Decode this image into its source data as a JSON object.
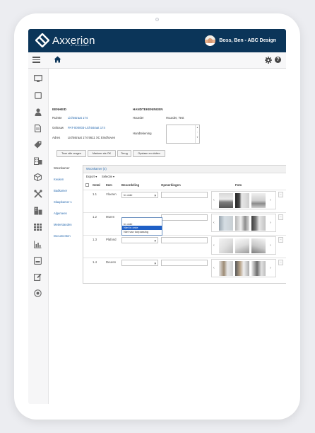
{
  "app": {
    "logo_text": "Axxerion",
    "logo_sub": "BY SPACEWELL",
    "user_label": "Boss, Ben - ABC Design"
  },
  "icons": {
    "menu": "hamburger-menu-icon",
    "home": "home-icon",
    "settings": "gear-icon",
    "help": "help-icon",
    "help_glyph": "?"
  },
  "eenheid": {
    "heading": "EENHEID",
    "ruimte_label": "Ruimte",
    "ruimte_value": "Lichtstraat 174",
    "gebouw_label": "Gebouw",
    "gebouw_value": "PAT-000003-Lichtstraat 174",
    "adres_label": "Adres",
    "adres_value": "Lichtstraat 174 5611 XC Eindhoven"
  },
  "handtekeningen": {
    "heading": "HANDTEKENINGEN",
    "huurder_label": "Huurder",
    "huurder_value": "Huurder, Test",
    "handtekening_label": "Handtekening"
  },
  "buttons": {
    "toon_alle_vragen": "Toon alle vragen",
    "markeer_als_ok": "Markeer als OK",
    "terug": "Terug",
    "opslaan_en_sluiten": "Opslaan en sluiten"
  },
  "tabs": [
    "Woonkamer",
    "Keuken",
    "Badkamer",
    "Slaapkamer 1",
    "Algemeen",
    "Meterstanden",
    "Documenten"
  ],
  "panel": {
    "title": "Woonkamer (4)",
    "export_label": "Export ▾",
    "selectie_label": "Selectie ▾",
    "columns": [
      "Getal",
      "Item",
      "Beoordeling",
      "Opmerkingen",
      "Foto"
    ],
    "rows": [
      {
        "getal": "1.1",
        "item": "Vloeren",
        "beoordeling": "In orde"
      },
      {
        "getal": "1.2",
        "item": "Muren",
        "beoordeling": ""
      },
      {
        "getal": "1.3",
        "item": "Plafond",
        "beoordeling": ""
      },
      {
        "getal": "1.4",
        "item": "Deuren",
        "beoordeling": ""
      }
    ],
    "dropdown_options": [
      "",
      "In orde",
      "Niet in orde",
      "Niet van toepassing"
    ],
    "dropdown_selected": "Niet in orde"
  },
  "colors": {
    "topbar": "#0b3559",
    "link": "#2b6cb0",
    "dropdown_highlight": "#1e5fc6"
  }
}
